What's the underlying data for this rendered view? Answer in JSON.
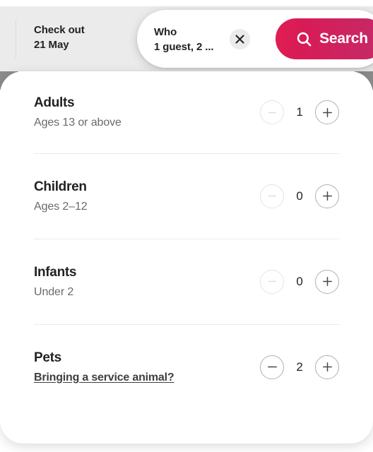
{
  "header": {
    "checkout": {
      "label": "Check out",
      "value": "21 May"
    },
    "who": {
      "label": "Who",
      "value": "1 guest, 2 ..."
    },
    "clear_icon": "close-icon",
    "search_button": {
      "label": "Search",
      "icon": "search-icon"
    },
    "background_color": "#ebebeb",
    "search_gradient_from": "#E11E52",
    "search_gradient_to": "#C42B68"
  },
  "panel": {
    "rows": [
      {
        "title": "Adults",
        "subtitle": "Ages 13 or above",
        "subtitle_is_link": false,
        "count": "1",
        "decrement_enabled": false,
        "increment_enabled": true,
        "decrement_icon": "minus-icon",
        "increment_icon": "plus-icon"
      },
      {
        "title": "Children",
        "subtitle": "Ages 2–12",
        "subtitle_is_link": false,
        "count": "0",
        "decrement_enabled": false,
        "increment_enabled": true,
        "decrement_icon": "minus-icon",
        "increment_icon": "plus-icon"
      },
      {
        "title": "Infants",
        "subtitle": "Under 2",
        "subtitle_is_link": false,
        "count": "0",
        "decrement_enabled": false,
        "increment_enabled": true,
        "decrement_icon": "minus-icon",
        "increment_icon": "plus-icon"
      },
      {
        "title": "Pets",
        "subtitle": "Bringing a service animal?",
        "subtitle_is_link": true,
        "count": "2",
        "decrement_enabled": true,
        "increment_enabled": true,
        "decrement_icon": "minus-icon",
        "increment_icon": "plus-icon"
      }
    ]
  }
}
